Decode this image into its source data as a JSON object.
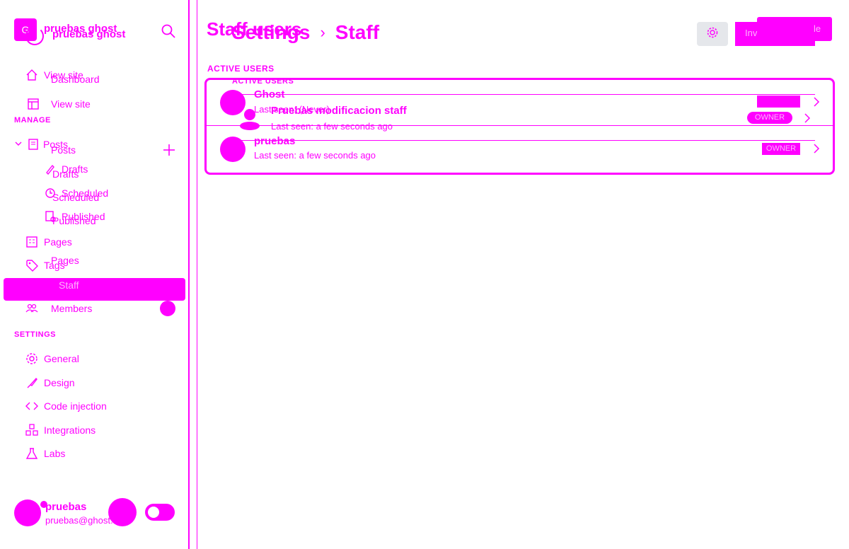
{
  "sidebar": {
    "site_badge": "G",
    "site_name": "pruebas ghost",
    "site_name_dup": "pruebas ghost",
    "nav": {
      "view_site_a": "View site",
      "dashboard": "Dashboard",
      "view_site_b": "View site",
      "posts_a": "Posts",
      "posts_b": "Posts",
      "drafts_a": "Drafts",
      "drafts_b": "Drafts",
      "scheduled_a": "Scheduled",
      "scheduled_b": "Scheduled",
      "published_a": "Published",
      "published_b": "Published",
      "pages_a": "Pages",
      "pages_b": "Pages",
      "tags": "Tags",
      "staff": "Staff",
      "members": "Members",
      "general": "General",
      "design": "Design",
      "code_injection": "Code injection",
      "integrations": "Integrations",
      "labs": "Labs"
    },
    "section_manage": "MANAGE",
    "section_settings": "SETTINGS",
    "footer": {
      "user_name": "pruebas",
      "user_email": "pruebas@ghost.org"
    }
  },
  "header": {
    "title": "Staff users",
    "breadcrumb_parent": "Settings",
    "breadcrumb_sep": "›",
    "breadcrumb_current": "Staff",
    "invite_label": "Invite people",
    "invite_label_dup": "le"
  },
  "users": {
    "section_title": "ACTIVE USERS",
    "section_title_dup": "ACTIVE USERS",
    "rows": [
      {
        "name": "Ghost",
        "last_seen": "Last seen: (Never)",
        "role": ""
      },
      {
        "name": "Pruebas modificacion staff",
        "last_seen": "Last seen: a few seconds ago",
        "role": "OWNER"
      },
      {
        "name": "pruebas",
        "last_seen": "Last seen: a few seconds ago",
        "role": "OWNER"
      }
    ]
  },
  "colors": {
    "accent": "#ff00ff",
    "gear_bg": "#e5e7eb"
  }
}
